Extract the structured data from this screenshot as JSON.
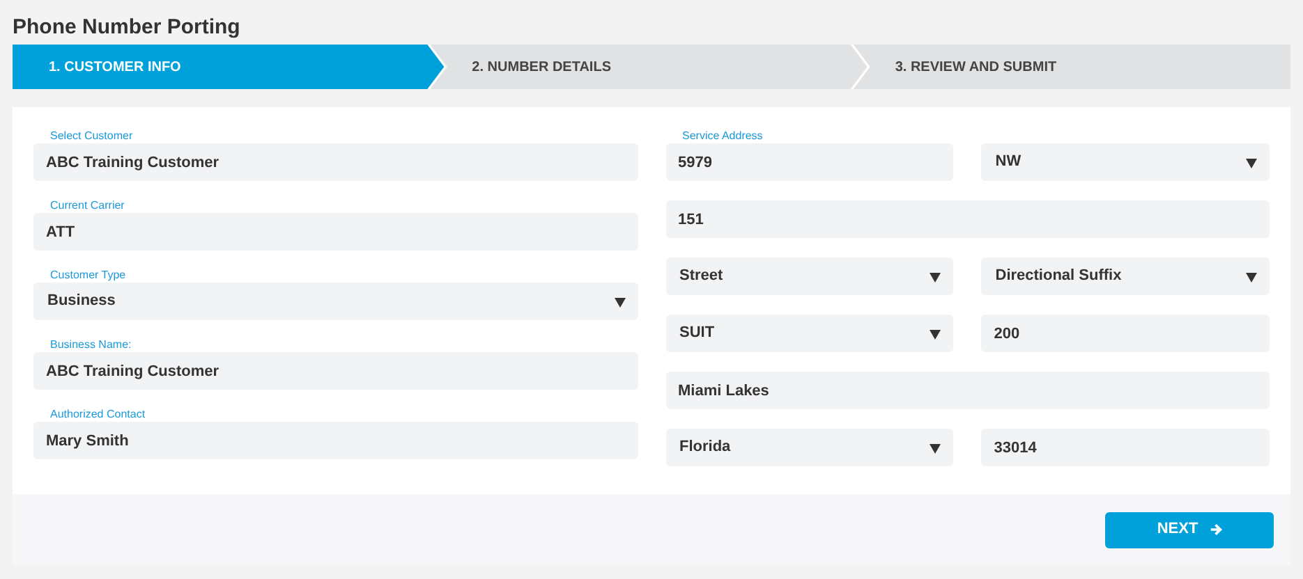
{
  "title": "Phone Number Porting",
  "steps": [
    {
      "label": "1. CUSTOMER INFO",
      "selected": true
    },
    {
      "label": "2. NUMBER DETAILS",
      "selected": false
    },
    {
      "label": "3. REVIEW AND SUBMIT",
      "selected": false
    }
  ],
  "customer_fields": [
    {
      "label": "Select Customer",
      "kind": "input",
      "value": "ABC Training Customer"
    },
    {
      "label": "Current Carrier",
      "kind": "input",
      "value": "ATT"
    },
    {
      "label": "Customer Type",
      "kind": "select",
      "value": "Business"
    },
    {
      "label": "Business Name:",
      "kind": "input",
      "value": "ABC Training Customer"
    },
    {
      "label": "Authorized Contact",
      "kind": "input",
      "value": "Mary Smith"
    }
  ],
  "service_address": {
    "label": "Service Address",
    "rows": [
      [
        {
          "kind": "input",
          "value": "5979"
        },
        {
          "kind": "select",
          "value": "NW"
        }
      ],
      [
        {
          "kind": "input",
          "value": "151"
        }
      ],
      [
        {
          "kind": "select",
          "value": "Street"
        },
        {
          "kind": "select",
          "value": "Directional Suffix"
        }
      ],
      [
        {
          "kind": "select",
          "value": "SUIT"
        },
        {
          "kind": "input",
          "value": "200"
        }
      ],
      [
        {
          "kind": "input",
          "value": "Miami Lakes"
        }
      ],
      [
        {
          "kind": "select",
          "value": "Florida"
        },
        {
          "kind": "input",
          "value": "33014"
        }
      ]
    ]
  },
  "next_button": {
    "label": "NEXT"
  }
}
